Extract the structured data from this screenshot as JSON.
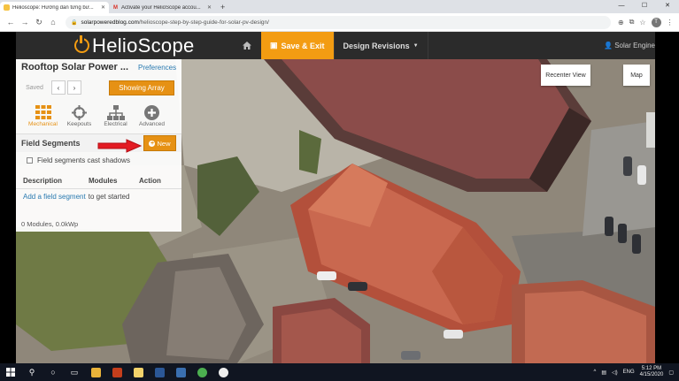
{
  "browser": {
    "tabs": [
      {
        "title": "Helioscope: Hướng dẫn từng bư...",
        "active": true
      },
      {
        "title": "Activate your HelioScope accou...",
        "active": false
      }
    ],
    "new_tab": "+",
    "window_controls": [
      "—",
      "☐",
      "✕"
    ],
    "url_host": "solarpoweredblog.com",
    "url_path": "/helioscope-step-by-step-guide-for-solar-pv-design/",
    "profile_initial": "T"
  },
  "app": {
    "logo_text": "HelioScope",
    "save_exit_label": "Save & Exit",
    "design_revisions_label": "Design Revisions",
    "user_label": "Solar Engine",
    "accent_color": "#f39c12"
  },
  "panel": {
    "title": "Rooftop Solar Power ...",
    "preferences_link": "Preferences",
    "saved_label": "Saved",
    "show_array_label": "Showing Array",
    "tools": [
      {
        "label": "Mechanical",
        "icon": "grid-icon",
        "active": true
      },
      {
        "label": "Keepouts",
        "icon": "crosshair-icon",
        "active": false
      },
      {
        "label": "Electrical",
        "icon": "hierarchy-icon",
        "active": false
      },
      {
        "label": "Advanced",
        "icon": "plus-circle-icon",
        "active": false
      }
    ],
    "field_segments": {
      "title": "Field Segments",
      "new_label": "New",
      "cast_shadows_label": "Field segments cast shadows",
      "cast_shadows_checked": false,
      "columns": [
        "Description",
        "Modules",
        "Action"
      ],
      "add_link": "Add a field segment",
      "add_suffix": "to get started",
      "summary": "0 Modules, 0.0kWp"
    }
  },
  "map": {
    "recenter_label": "Recenter View",
    "map_type_label": "Map"
  },
  "taskbar": {
    "language": "ENG",
    "time": "5:12 PM",
    "date": "4/15/2020"
  }
}
